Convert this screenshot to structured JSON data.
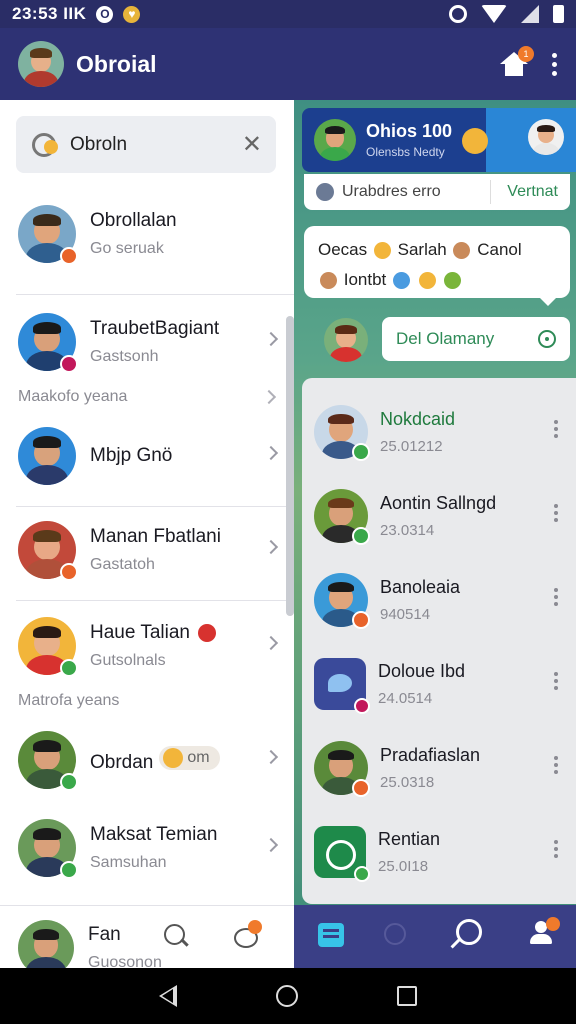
{
  "status_bar": {
    "time": "23:53 IIK",
    "icon_left_1": "O",
    "icon_left_2": "♥"
  },
  "app_bar": {
    "title": "Obroial",
    "home_badge": "1"
  },
  "search": {
    "value": "Obroln"
  },
  "contacts": [
    {
      "name": "Obrollalan",
      "sub": "Go seruak"
    },
    {
      "name": "TraubetBagiant",
      "sub": "Gastsonh"
    },
    {
      "name": "Mbjp Gnö",
      "sub": ""
    },
    {
      "name": "Manan Fbatlani",
      "sub": "Gastatoh"
    },
    {
      "name": "Haue Talian",
      "sub": "Gutsolnals"
    },
    {
      "name": "Obrdan",
      "pill": "om",
      "sub": ""
    },
    {
      "name": "Maksat Temian",
      "sub": "Samsuhan"
    }
  ],
  "sections": [
    "Maakofo yeana",
    "Matrofa yeans"
  ],
  "left_bottom": {
    "name": "Fan",
    "sub": "Guosonon"
  },
  "chat": {
    "title": "Ohios 100",
    "subtitle": "Olensbs Nedty",
    "bubble1_text": "Urabdres erro",
    "bubble1_button": "Vertnat",
    "bubble2_line1": "Oecas",
    "bubble2_word2": "Sarlah",
    "bubble2_word3": "Canol",
    "bubble2_line2": "Iontbt",
    "action_label": "Del Olamany"
  },
  "conversations": [
    {
      "name": "Nokdcaid",
      "date": "25.01212"
    },
    {
      "name": "Aontin Sallngd",
      "date": "23.0314"
    },
    {
      "name": "Banoleaia",
      "date": "940514"
    },
    {
      "name": "Doloue Ibd",
      "date": "24.0514"
    },
    {
      "name": "Pradafiaslan",
      "date": "25.0318"
    },
    {
      "name": "Rentian",
      "date": "25.0I18"
    }
  ],
  "colors": {
    "app_bar": "#2e3274",
    "accent_green": "#2e8b57",
    "badge_orange": "#f07a2b"
  },
  "icons": [
    "search-icon",
    "close-icon",
    "home-icon",
    "more-vert-icon",
    "chevron-right-icon",
    "chat-icon",
    "list-icon",
    "person-icon",
    "back-icon",
    "circle-home-icon",
    "recent-apps-icon"
  ]
}
